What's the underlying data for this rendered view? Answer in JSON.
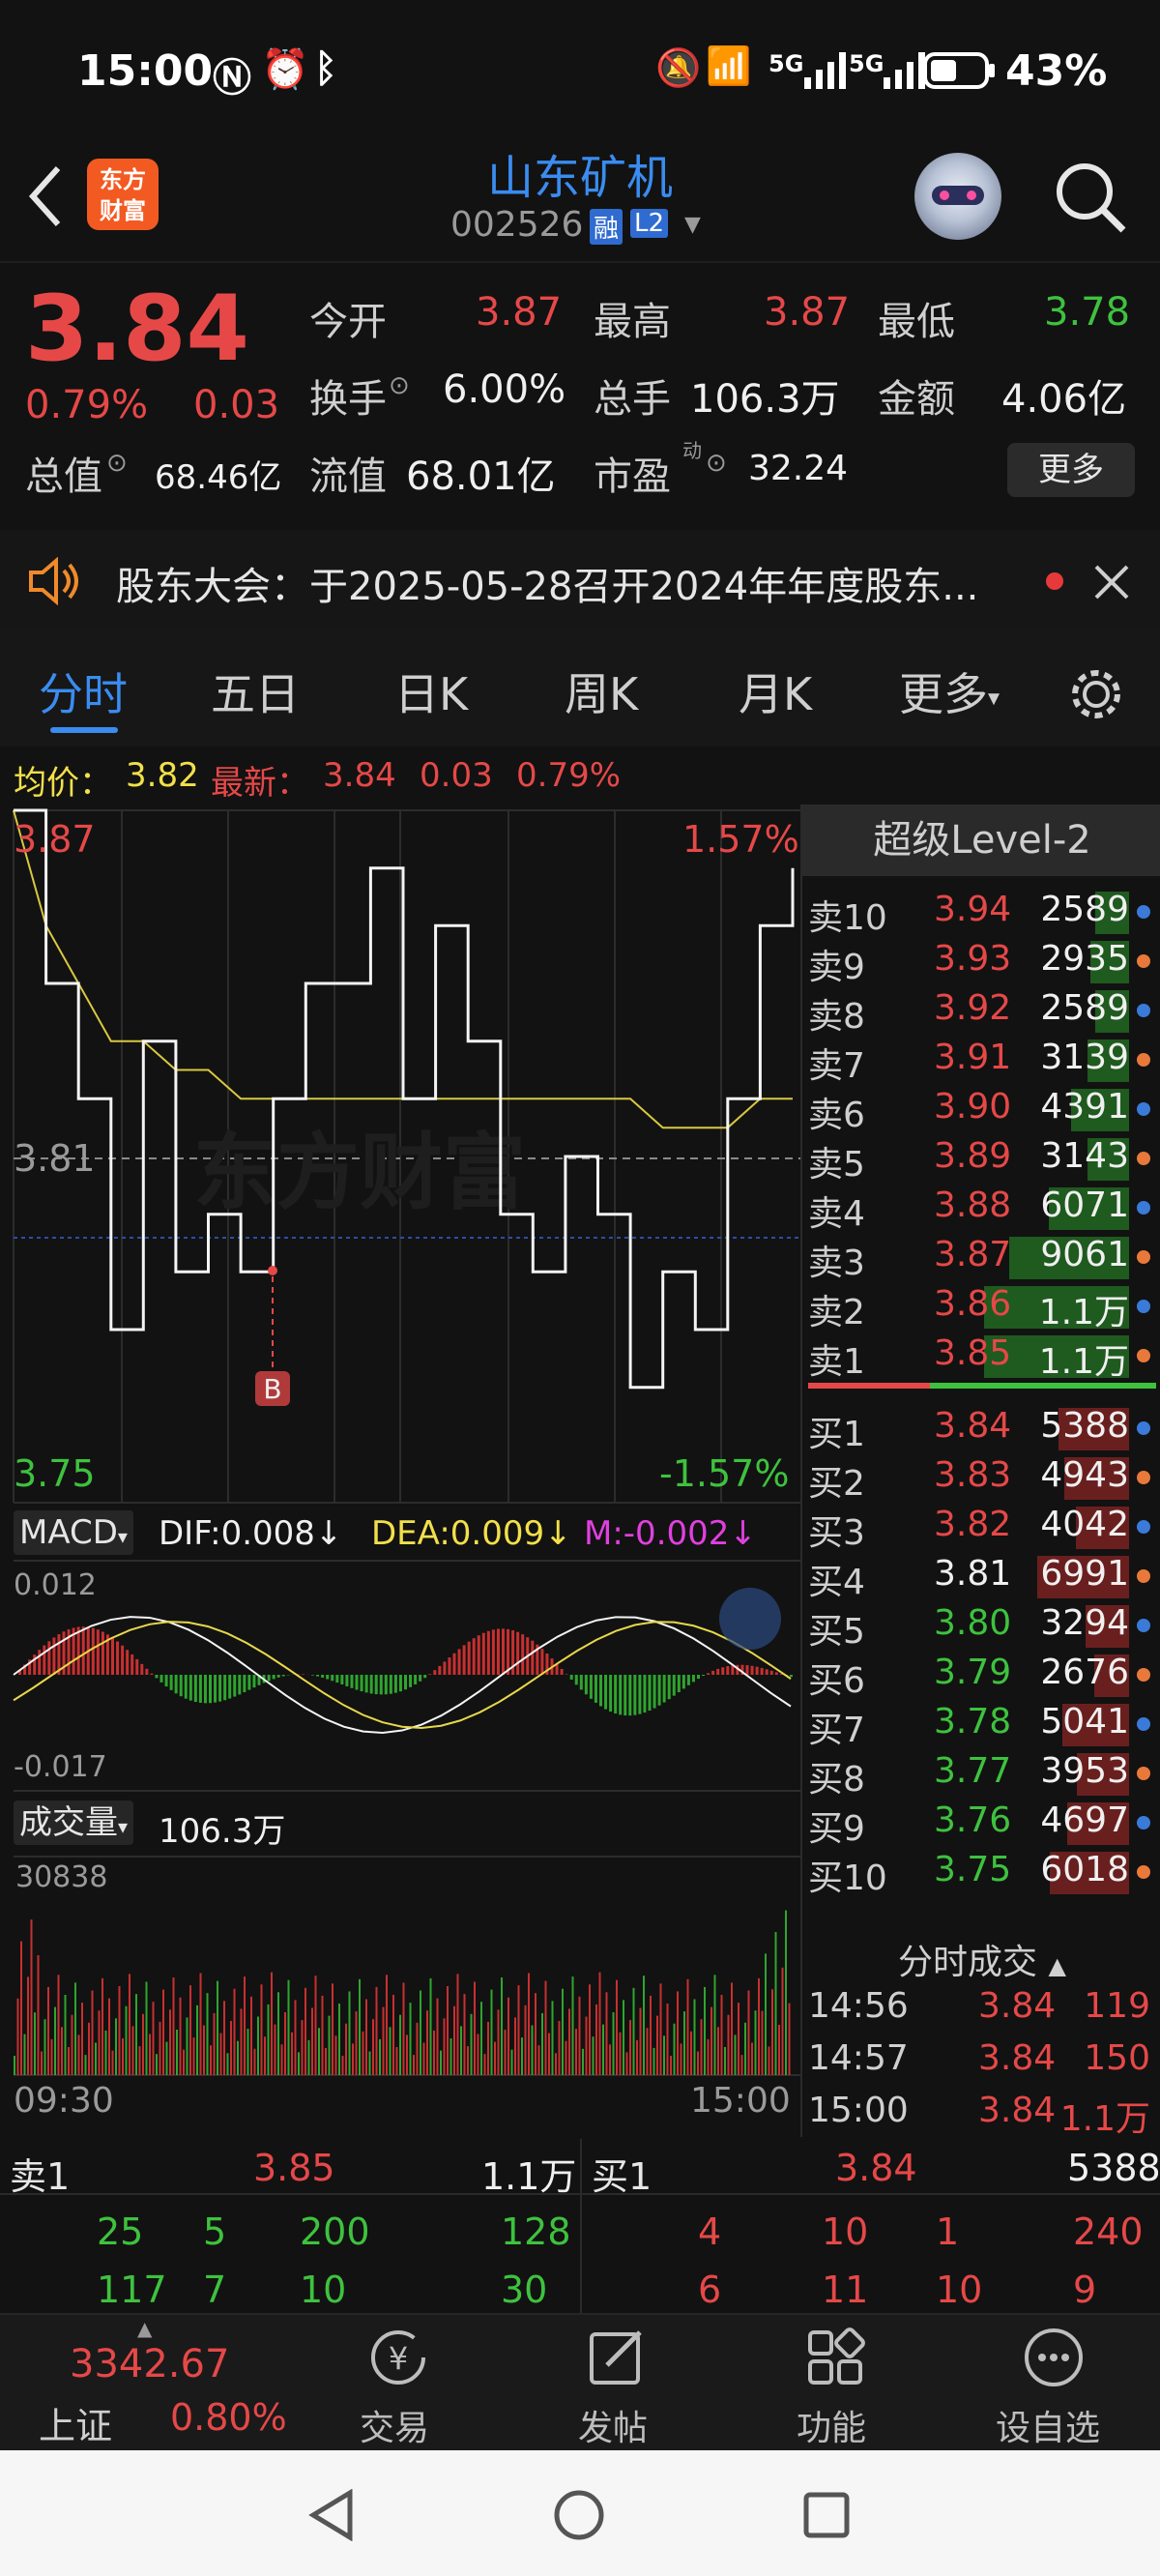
{
  "status": {
    "time": "15:00",
    "battery": "43%",
    "net1": "5G",
    "net2": "5G"
  },
  "header": {
    "title": "山东矿机",
    "code": "002526",
    "badge_rong": "融",
    "badge_l2": "L2",
    "logo_line1": "东方",
    "logo_line2": "财富"
  },
  "quote": {
    "price": "3.84",
    "pct": "0.79%",
    "change": "0.03",
    "open_label": "今开",
    "open": "3.87",
    "high_label": "最高",
    "high": "3.87",
    "low_label": "最低",
    "low": "3.78",
    "turnover_label": "换手",
    "turnover": "6.00%",
    "vol_label": "总手",
    "vol": "106.3万",
    "amount_label": "金额",
    "amount": "4.06亿",
    "mktcap_label": "总值",
    "mktcap": "68.46亿",
    "float_label": "流值",
    "float": "68.01亿",
    "pe_label": "市盈",
    "pe_sup": "动",
    "pe": "32.24",
    "more": "更多"
  },
  "notice": {
    "text": "股东大会：于2025-05-28召开2024年年度股东..."
  },
  "tabs": [
    "分时",
    "五日",
    "日K",
    "周K",
    "月K",
    "更多"
  ],
  "info": {
    "avg_label": "均价：",
    "avg": "3.82",
    "latest_label": "最新：",
    "latest": "3.84",
    "chg": "0.03",
    "pct": "0.79%"
  },
  "chart": {
    "top_price": "3.87",
    "top_pct": "1.57%",
    "mid_price": "3.81",
    "bottom_price": "3.75",
    "bottom_pct": "-1.57%",
    "marker": "B",
    "watermark": "东方财富",
    "macd_label": "MACD",
    "dif": "DIF:0.008",
    "dea": "DEA:0.009",
    "m": "M:-0.002",
    "macd_top": "0.012",
    "macd_bottom": "-0.017",
    "vol_label": "成交量",
    "vol_total": "106.3万",
    "vol_max": "30838",
    "time_start": "09:30",
    "time_end": "15:00"
  },
  "chart_data": {
    "type": "line",
    "xlabel": "",
    "ylabel": "",
    "ylim": [
      3.75,
      3.87
    ],
    "series": [
      {
        "values": [
          3.87,
          3.84,
          3.82,
          3.78,
          3.83,
          3.79,
          3.8,
          3.79,
          3.82,
          3.84,
          3.84,
          3.86,
          3.82,
          3.85,
          3.83,
          3.8,
          3.79,
          3.81,
          3.8,
          3.77,
          3.79,
          3.78,
          3.82,
          3.85,
          3.86
        ]
      },
      {
        "values": [
          3.87,
          3.85,
          3.84,
          3.83,
          3.83,
          3.825,
          3.825,
          3.82,
          3.82,
          3.82,
          3.82,
          3.82,
          3.82,
          3.82,
          3.82,
          3.82,
          3.82,
          3.82,
          3.82,
          3.82,
          3.815,
          3.815,
          3.815,
          3.82,
          3.82
        ]
      }
    ]
  },
  "level2": {
    "title": "超级Level-2",
    "sells": [
      {
        "l": "卖10",
        "p": "3.94",
        "v": "2589"
      },
      {
        "l": "卖9",
        "p": "3.93",
        "v": "2935"
      },
      {
        "l": "卖8",
        "p": "3.92",
        "v": "2589"
      },
      {
        "l": "卖7",
        "p": "3.91",
        "v": "3139"
      },
      {
        "l": "卖6",
        "p": "3.90",
        "v": "4391"
      },
      {
        "l": "卖5",
        "p": "3.89",
        "v": "3143"
      },
      {
        "l": "卖4",
        "p": "3.88",
        "v": "6071"
      },
      {
        "l": "卖3",
        "p": "3.87",
        "v": "9061"
      },
      {
        "l": "卖2",
        "p": "3.86",
        "v": "1.1万"
      },
      {
        "l": "卖1",
        "p": "3.85",
        "v": "1.1万"
      }
    ],
    "buys": [
      {
        "l": "买1",
        "p": "3.84",
        "v": "5388"
      },
      {
        "l": "买2",
        "p": "3.83",
        "v": "4943"
      },
      {
        "l": "买3",
        "p": "3.82",
        "v": "4042"
      },
      {
        "l": "买4",
        "p": "3.81",
        "v": "6991"
      },
      {
        "l": "买5",
        "p": "3.80",
        "v": "3294"
      },
      {
        "l": "买6",
        "p": "3.79",
        "v": "2676"
      },
      {
        "l": "买7",
        "p": "3.78",
        "v": "5041"
      },
      {
        "l": "买8",
        "p": "3.77",
        "v": "3953"
      },
      {
        "l": "买9",
        "p": "3.76",
        "v": "4697"
      },
      {
        "l": "买10",
        "p": "3.75",
        "v": "6018"
      }
    ],
    "ticks_title": "分时成交",
    "ticks": [
      {
        "t": "14:56",
        "p": "3.84",
        "v": "119"
      },
      {
        "t": "14:57",
        "p": "3.84",
        "v": "150"
      },
      {
        "t": "15:00",
        "p": "3.84",
        "v": "1.1万"
      }
    ]
  },
  "orderbook": {
    "sell_label": "卖1",
    "sell_price": "3.85",
    "sell_vol": "1.1万",
    "buy_label": "买1",
    "buy_price": "3.84",
    "buy_vol": "5388",
    "sell_row1": [
      "25",
      "5",
      "200",
      "128"
    ],
    "buy_row1": [
      "4",
      "10",
      "1",
      "240"
    ],
    "sell_row2": [
      "117",
      "7",
      "10",
      "30"
    ],
    "buy_row2": [
      "6",
      "11",
      "10",
      "9"
    ]
  },
  "nav": {
    "index_value": "3342.67",
    "index_name": "上证",
    "index_pct": "0.80%",
    "trade": "交易",
    "post": "发帖",
    "func": "功能",
    "watch": "设自选"
  }
}
